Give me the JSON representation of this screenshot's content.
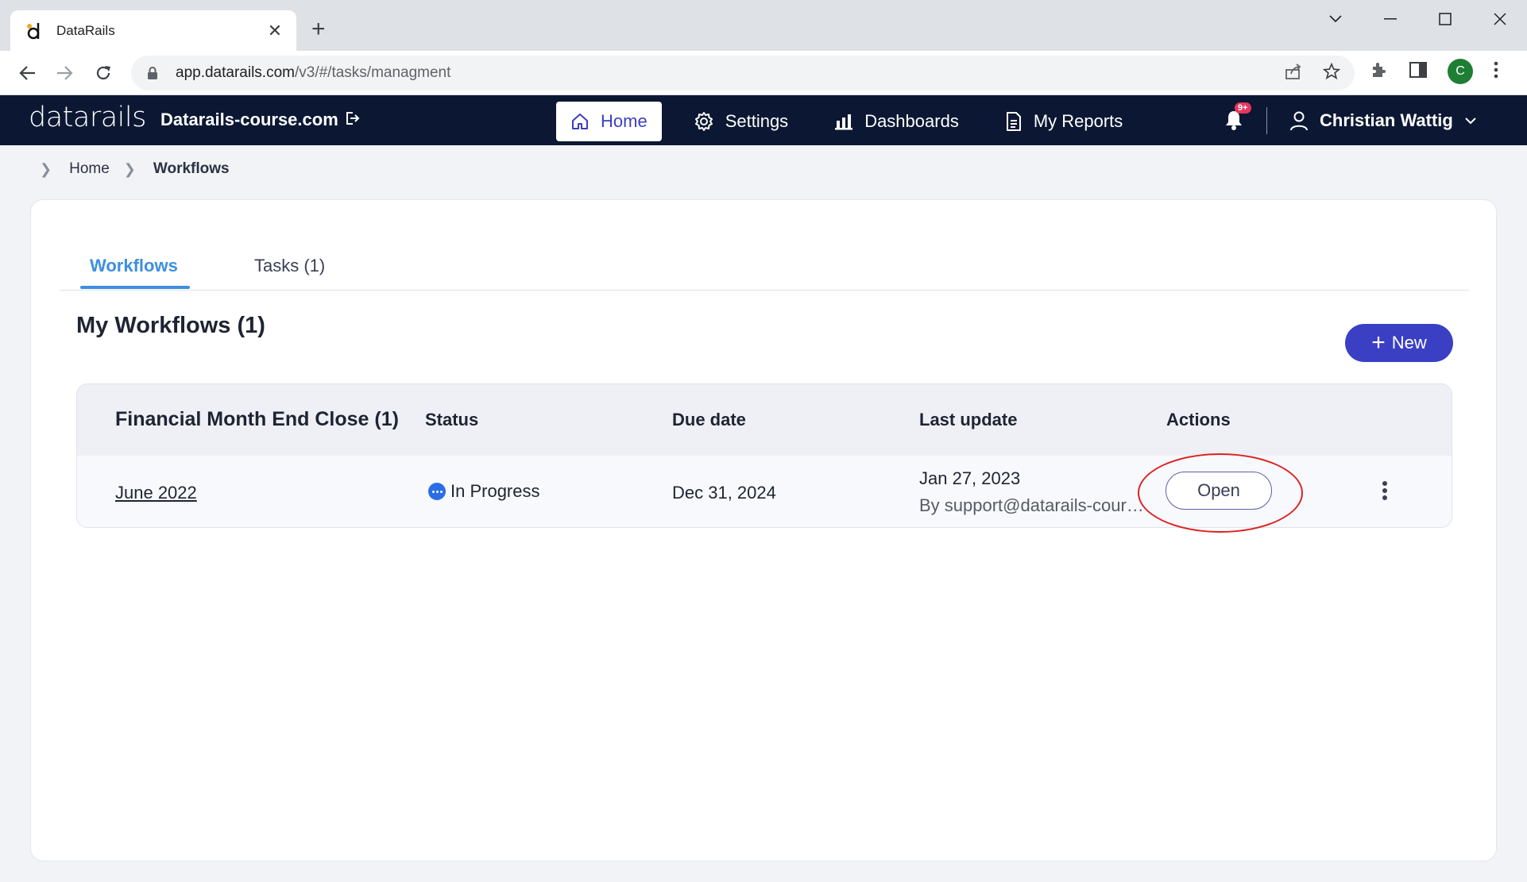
{
  "browser": {
    "tab_title": "DataRails",
    "url_host": "app.datarails.com",
    "url_path": "/v3/#/tasks/managment",
    "profile_initial": "C"
  },
  "header": {
    "logo": "datarails",
    "domain": "Datarails-course.com",
    "nav": [
      {
        "label": "Home",
        "icon": "home-icon"
      },
      {
        "label": "Settings",
        "icon": "gear-icon"
      },
      {
        "label": "Dashboards",
        "icon": "bar-chart-icon"
      },
      {
        "label": "My Reports",
        "icon": "document-icon"
      }
    ],
    "notification_badge": "9+",
    "user_name": "Christian Wattig"
  },
  "breadcrumb": {
    "home": "Home",
    "current": "Workflows"
  },
  "tabs": [
    {
      "label": "Workflows"
    },
    {
      "label": "Tasks (1)"
    }
  ],
  "section": {
    "title": "My Workflows (1)",
    "new_button": "New"
  },
  "table": {
    "group_title": "Financial Month End Close  (1)",
    "columns": {
      "status": "Status",
      "due_date": "Due date",
      "last_update": "Last update",
      "actions": "Actions"
    },
    "rows": [
      {
        "period": "June 2022",
        "status": "In Progress",
        "due_date": "Dec 31, 2024",
        "last_update_date": "Jan 27, 2023",
        "last_update_by": "By support@datarails-course.com",
        "action": "Open"
      }
    ]
  },
  "colors": {
    "header_bg": "#0c1833",
    "accent": "#3b3fc4",
    "tab_active": "#3d8fe0",
    "status_in_progress": "#2b6de6",
    "annotation": "#dd2222"
  }
}
